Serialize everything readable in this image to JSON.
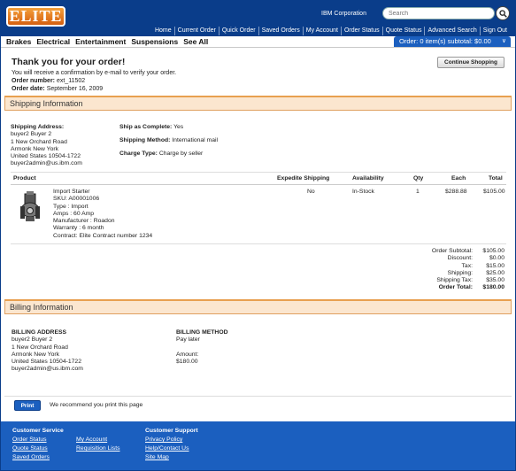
{
  "header": {
    "logo": "ELITE",
    "organization": "IBM Corporation",
    "search_placeholder": "Search",
    "nav": [
      "Home",
      "Current Order",
      "Quick Order",
      "Saved Orders",
      "My Account",
      "Order Status",
      "Quote Status",
      "Advanced Search",
      "Sign Out"
    ]
  },
  "categories": [
    "Brakes",
    "Electrical",
    "Entertainment",
    "Suspensions",
    "See All"
  ],
  "cart": {
    "summary": "Order: 0 item(s) subtotal: $0.00"
  },
  "order": {
    "thanks": "Thank you for your order!",
    "confirmation": "You will receive a confirmation by e-mail to verify your order.",
    "number_label": "Order number:",
    "number": "ext_11502",
    "date_label": "Order date:",
    "date": "September 16, 2009",
    "continue_label": "Continue Shopping"
  },
  "shipping": {
    "section_title": "Shipping Information",
    "address_label": "Shipping Address:",
    "address_lines": [
      "buyer2 Buyer 2",
      "1 New Orchard Road",
      "Armonk New York",
      "United States 10504-1722",
      "buyer2admin@us.ibm.com"
    ],
    "ship_complete_label": "Ship as Complete:",
    "ship_complete": "Yes",
    "method_label": "Shipping Method:",
    "method": "International mail",
    "charge_label": "Charge Type:",
    "charge": "Charge by seller"
  },
  "table": {
    "headers": {
      "product": "Product",
      "expedite": "Expedite Shipping",
      "availability": "Availability",
      "qty": "Qty",
      "each": "Each",
      "total": "Total"
    },
    "item": {
      "lines": [
        "Import Starter",
        "SKU: A00001006",
        "Type : Import",
        "Amps : 60 Amp",
        "Manufacturer : Roadon",
        "Warranty : 6 month",
        "Contract: Elite Contract number 1234"
      ],
      "expedite": "No",
      "availability": "In-Stock",
      "qty": "1",
      "each": "$288.88",
      "total": "$105.00"
    }
  },
  "totals": [
    {
      "label": "Order Subtotal:",
      "value": "$105.00",
      "bold": false
    },
    {
      "label": "Discount:",
      "value": "$0.00",
      "bold": false
    },
    {
      "label": "Tax:",
      "value": "$15.00",
      "bold": false
    },
    {
      "label": "Shipping:",
      "value": "$25.00",
      "bold": false
    },
    {
      "label": "Shipping Tax:",
      "value": "$35.00",
      "bold": false
    },
    {
      "label": "Order Total:",
      "value": "$180.00",
      "bold": true
    }
  ],
  "billing": {
    "section_title": "Billing Information",
    "address_heading": "BILLING ADDRESS",
    "address_lines": [
      "buyer2 Buyer 2",
      "1 New Orchard Road",
      "Armonk New York",
      "United States 10504-1722",
      "buyer2admin@us.ibm.com"
    ],
    "method_heading": "BILLING METHOD",
    "method": "Pay later",
    "amount_label": "Amount:",
    "amount": "$180.00"
  },
  "print": {
    "label": "Print",
    "message": "We recommend you print this page"
  },
  "footer": {
    "service_heading": "Customer Service",
    "service_col1": [
      "Order Status",
      "Quote Status",
      "Saved Orders"
    ],
    "service_col2": [
      "My Account",
      "Requisition Lists"
    ],
    "support_heading": "Customer Support",
    "support_links": [
      "Privacy Policy",
      "Help/Contact Us",
      "Site Map"
    ]
  },
  "colors": {
    "header_blue": "#0a3d8a",
    "accent_orange": "#e8a050",
    "footer_blue": "#1b5fbf"
  }
}
